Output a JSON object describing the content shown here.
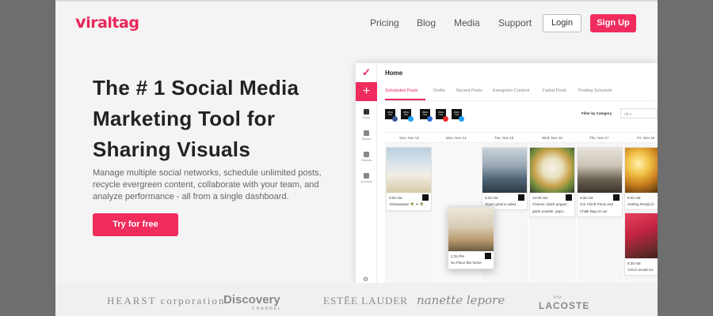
{
  "brand": {
    "name": "viraltag",
    "accent": "#f02c5e"
  },
  "nav": {
    "pricing": "Pricing",
    "blog": "Blog",
    "media": "Media",
    "support": "Support",
    "login": "Login",
    "signup": "Sign Up"
  },
  "hero": {
    "title_line1": "The # 1 Social Media",
    "title_line2": "Marketing Tool for",
    "title_line3": "Sharing Visuals",
    "sub_line1": "Manage multiple social networks, schedule unlimited posts,",
    "sub_line2": "recycle evergreen content, collaborate with your team, and",
    "sub_line3": "analyze performance - all from a single dashboard.",
    "cta": "Try for free"
  },
  "app": {
    "title": "Home",
    "sidebar": [
      {
        "label": "Home",
        "icon": "home-icon"
      },
      {
        "label": "Explore",
        "icon": "explore-icon"
      },
      {
        "label": "Reports",
        "icon": "reports-icon"
      },
      {
        "label": "Accounts",
        "icon": "accounts-icon"
      }
    ],
    "tabs": [
      "Scheduled Posts",
      "Drafts",
      "Recent Posts",
      "Evergreen Content",
      "Failed Posts",
      "Posting Schedule"
    ],
    "filter_label": "Filter by Category",
    "filter_value": "All C",
    "days": [
      "Sun, Nov 13",
      "Mon, Nov 14",
      "Tue, Nov 15",
      "Wed, Nov 16",
      "Thu, Nov 17",
      "Fri, Nov 18"
    ],
    "cards": [
      {
        "time": "9:00 AM",
        "caption": "Alohaaaaaa! 🌴 ☀ 🌴"
      },
      {
        "time": "9:30 AM",
        "caption": "Super greens salad..."
      },
      {
        "time": "10:00 AM",
        "caption": "Cheese, black pepper,"
      },
      {
        "time": "9:30 AM",
        "caption": "Our Climb Pants and"
      },
      {
        "time": "9:00 AM",
        "caption": "Getting Ready fo"
      }
    ],
    "card_extra": {
      "caption2": "garlic powder, papri...",
      "caption4": "Chalk Bag on our"
    },
    "drag_card": {
      "time": "2:25 PM",
      "caption": "No Place like home"
    },
    "friday_card2": {
      "time": "9:30 AM",
      "caption": "YOLO would rec"
    }
  },
  "logos": [
    "HEARST corporation",
    "Discovery",
    "CHANNEL",
    "ESTĒE LAUDER",
    "nanette lepore",
    "LACOSTE"
  ]
}
